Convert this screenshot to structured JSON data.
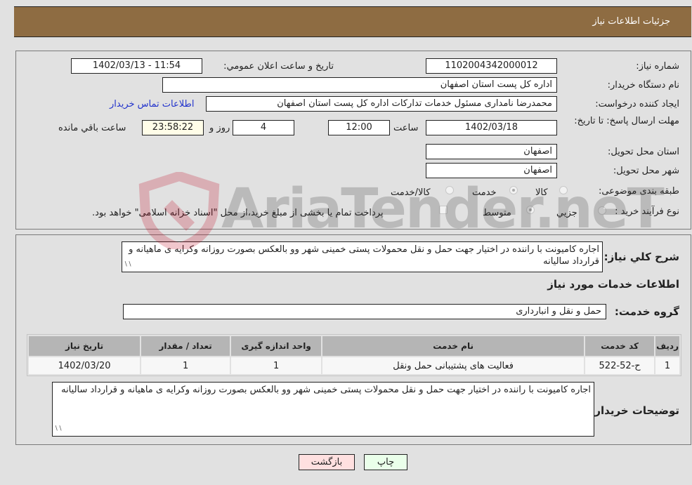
{
  "header": {
    "title": "جزئیات اطلاعات نیاز"
  },
  "form": {
    "need_number": {
      "label": "شماره نیاز:",
      "value": "1102004342000012"
    },
    "announce_datetime": {
      "label": "تاریخ و ساعت اعلان عمومي:",
      "value": "1402/03/13 - 11:54"
    },
    "buyer_org": {
      "label": "نام دستگاه خريدار:",
      "value": "اداره کل پست استان اصفهان"
    },
    "requester": {
      "label": "ایجاد کننده درخواست:",
      "value": "محمدرضا نامداری مسئول خدمات تدارکات اداره کل پست استان اصفهان",
      "contact_link": "اطلاعات تماس خريدار"
    },
    "deadline": {
      "label": "مهلت ارسال پاسخ: تا تاریخ:",
      "date": "1402/03/18",
      "time_label": "ساعت",
      "time": "12:00",
      "days": "4",
      "days_label": "روز و",
      "remaining": "23:58:22",
      "remaining_label": "ساعت باقي مانده"
    },
    "delivery_province": {
      "label": "استان محل تحویل:",
      "value": "اصفهان"
    },
    "delivery_city": {
      "label": "شهر محل تحویل:",
      "value": "اصفهان"
    },
    "category": {
      "label": "طبقه بندی موضوعی:",
      "options": [
        "کالا",
        "خدمت",
        "کالا/خدمت"
      ],
      "selected": "خدمت"
    },
    "purchase_type": {
      "label": "نوع فرآیند خرید :",
      "options": [
        "جزيي",
        "متوسط"
      ],
      "selected": "متوسط",
      "checkbox_label": "پرداخت تمام یا بخشی از مبلغ خرید،از محل \"اسناد خزانه اسلامی\" خواهد بود."
    }
  },
  "summary": {
    "label": "شرح كلي نياز:",
    "value": "اجاره کامیونت با راننده در اختیار جهت حمل و نقل محمولات پستی خمینی شهر وو بالعکس بصورت روزانه وکرایه ی ماهیانه و قرارداد سالیانه"
  },
  "services": {
    "section_title": "اطلاعات خدمات مورد نیاز",
    "group_label": "گروه خدمت:",
    "group_value": "حمل و نقل و انبارداری",
    "columns": [
      "ردیف",
      "کد خدمت",
      "نام خدمت",
      "واحد اندازه گیری",
      "تعداد / مقدار",
      "تاریخ نیاز"
    ],
    "rows": [
      [
        "1",
        "ح-52-522",
        "فعالیت های پشتیبانی حمل ونقل",
        "1",
        "1",
        "1402/03/20"
      ]
    ]
  },
  "buyer_notes": {
    "label": "توضیحات خریدار:",
    "value": "اجاره کامیونت با راننده در اختیار جهت حمل و نقل محمولات پستی خمینی شهر وو بالعکس بصورت روزانه وکرایه ی ماهیانه و قرارداد سالیانه"
  },
  "buttons": {
    "print": "چاپ",
    "back": "بازگشت"
  },
  "watermark": {
    "text": "AriaTender.neT"
  },
  "colors": {
    "header_bg": "#8e6c42",
    "back_btn": "#ffe0e0",
    "print_btn": "#eaffea",
    "timer_bg": "#fffde8",
    "link": "#2233cc"
  }
}
